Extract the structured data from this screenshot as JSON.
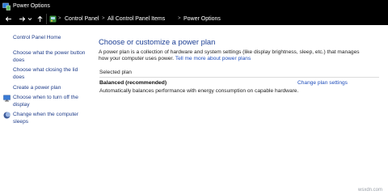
{
  "window": {
    "title": "Power Options",
    "icon": "power-options-icon"
  },
  "nav": {
    "back": "back-arrow-icon",
    "forward": "forward-arrow-icon",
    "recent": "chevron-down-icon",
    "up": "up-arrow-icon"
  },
  "breadcrumb": {
    "icon": "control-panel-icon",
    "items": [
      "Control Panel",
      "All Control Panel Items",
      "Power Options"
    ],
    "separator": ">"
  },
  "sidebar": {
    "home": "Control Panel Home",
    "items": [
      {
        "label": "Choose what the power button does"
      },
      {
        "label": "Choose what closing the lid does"
      },
      {
        "label": "Create a power plan"
      },
      {
        "label": "Choose when to turn off the display",
        "icon": "monitor-icon"
      },
      {
        "label": "Change when the computer sleeps",
        "icon": "moon-icon"
      }
    ]
  },
  "main": {
    "title": "Choose or customize a power plan",
    "description": "A power plan is a collection of hardware and system settings (like display brightness, sleep, etc.) that manages how your computer uses power.",
    "description_link": "Tell me more about power plans",
    "selected_label": "Selected plan",
    "plan": {
      "name": "Balanced (recommended)",
      "change_link": "Change plan settings",
      "description": "Automatically balances performance with energy consumption on capable hardware."
    }
  },
  "watermark": "wsxdn.com",
  "colors": {
    "titlebar": "#000000",
    "link": "#1f3d8a",
    "heading": "#1c3f94"
  }
}
